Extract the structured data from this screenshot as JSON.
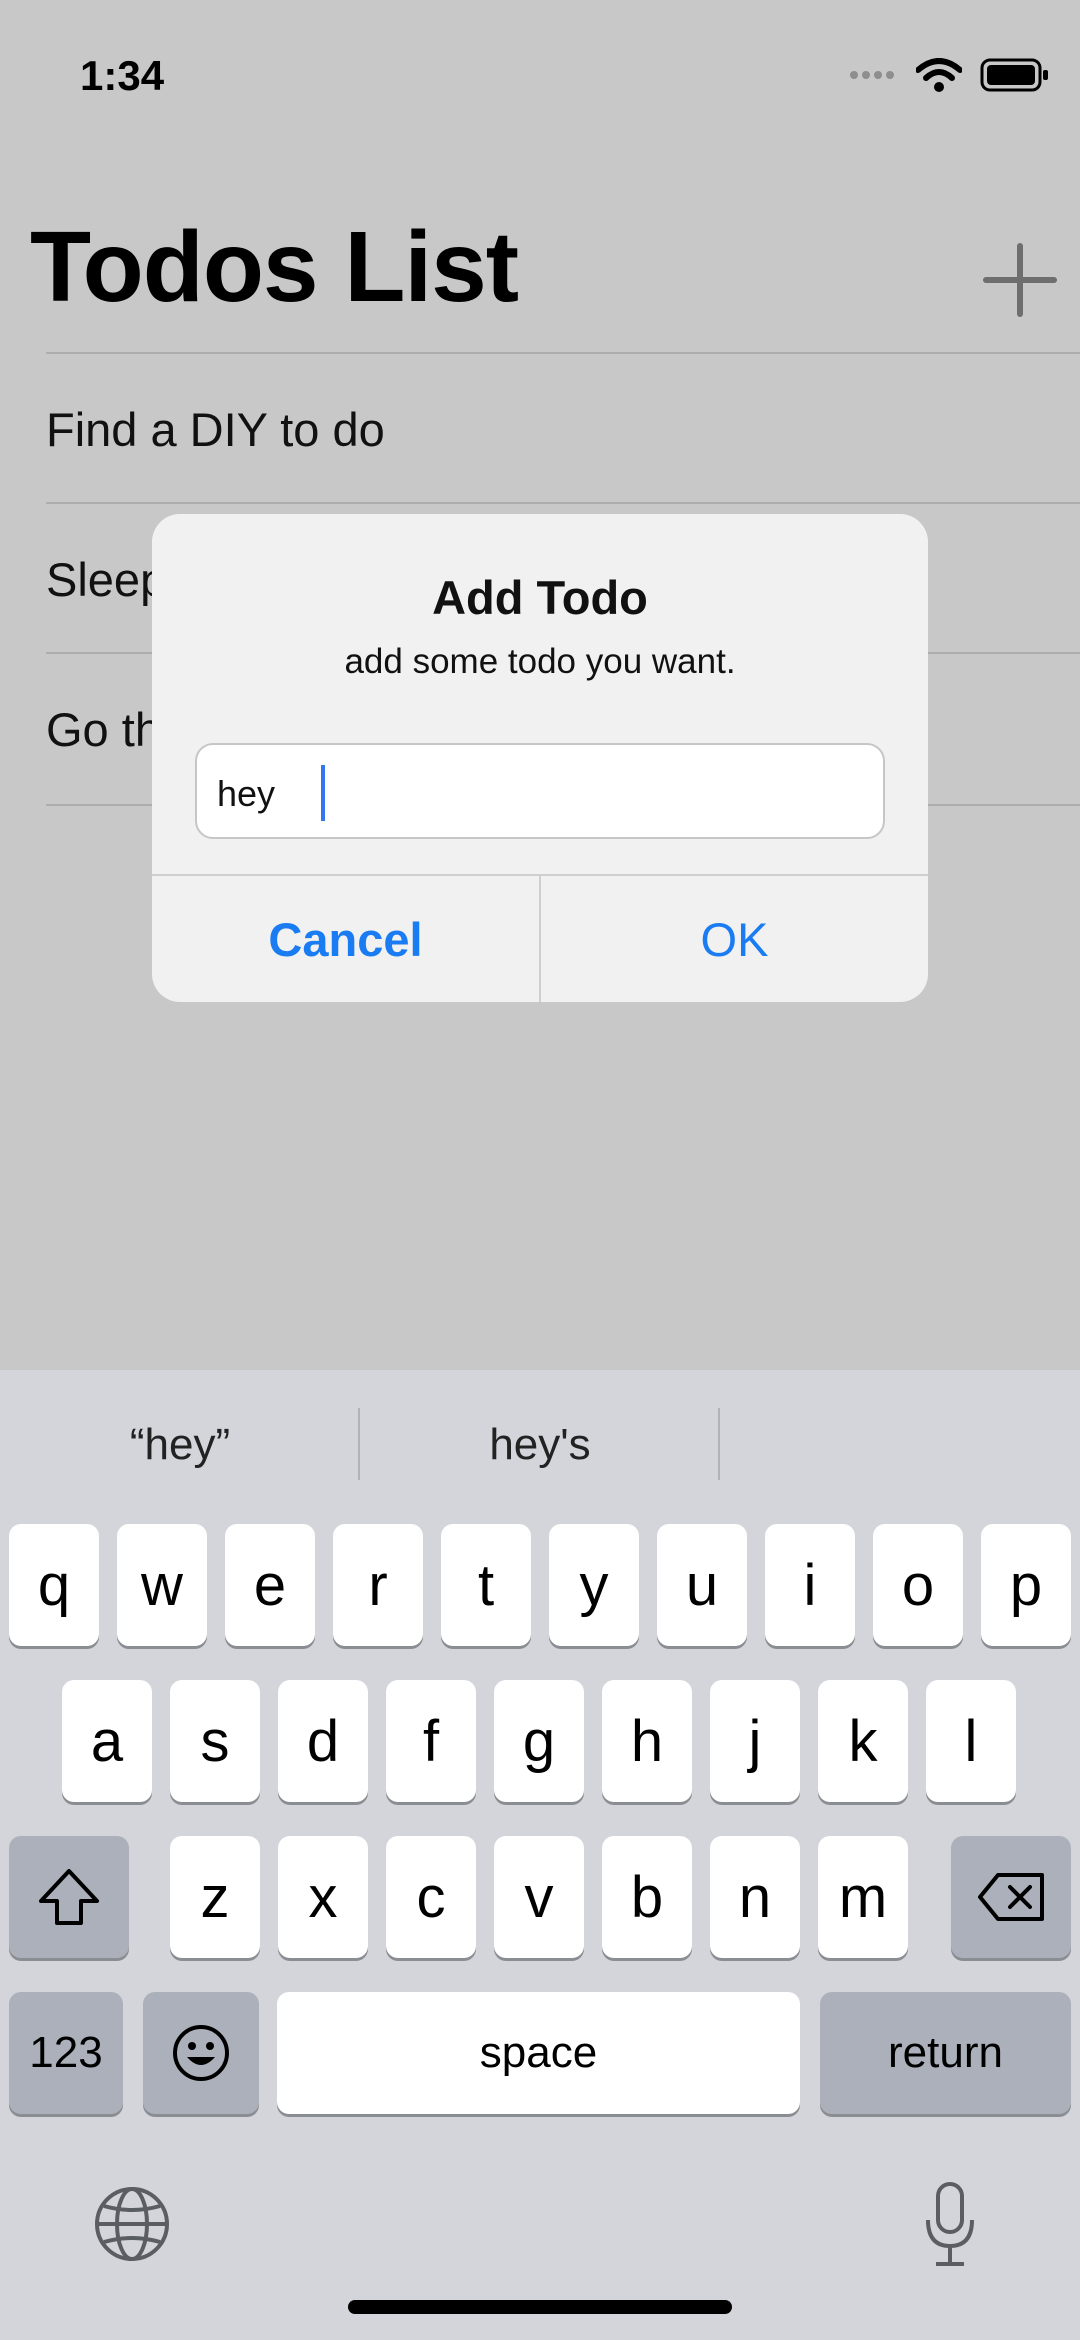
{
  "status_bar": {
    "time": "1:34"
  },
  "header": {
    "title": "Todos List",
    "add_icon": "plus-icon"
  },
  "todos": [
    {
      "label": "Find a DIY to do"
    },
    {
      "label": "Sleep"
    },
    {
      "label": "Go th"
    }
  ],
  "alert": {
    "title": "Add Todo",
    "message": "add some todo you want.",
    "input_value": "hey",
    "cancel_label": "Cancel",
    "ok_label": "OK"
  },
  "keyboard": {
    "suggestions": [
      "“hey”",
      "hey's",
      ""
    ],
    "row1": [
      "q",
      "w",
      "e",
      "r",
      "t",
      "y",
      "u",
      "i",
      "o",
      "p"
    ],
    "row2": [
      "a",
      "s",
      "d",
      "f",
      "g",
      "h",
      "j",
      "k",
      "l"
    ],
    "row3": [
      "z",
      "x",
      "c",
      "v",
      "b",
      "n",
      "m"
    ],
    "numbers_label": "123",
    "space_label": "space",
    "return_label": "return"
  },
  "colors": {
    "accent": "#1a7cf2",
    "caret": "#3377ee"
  }
}
